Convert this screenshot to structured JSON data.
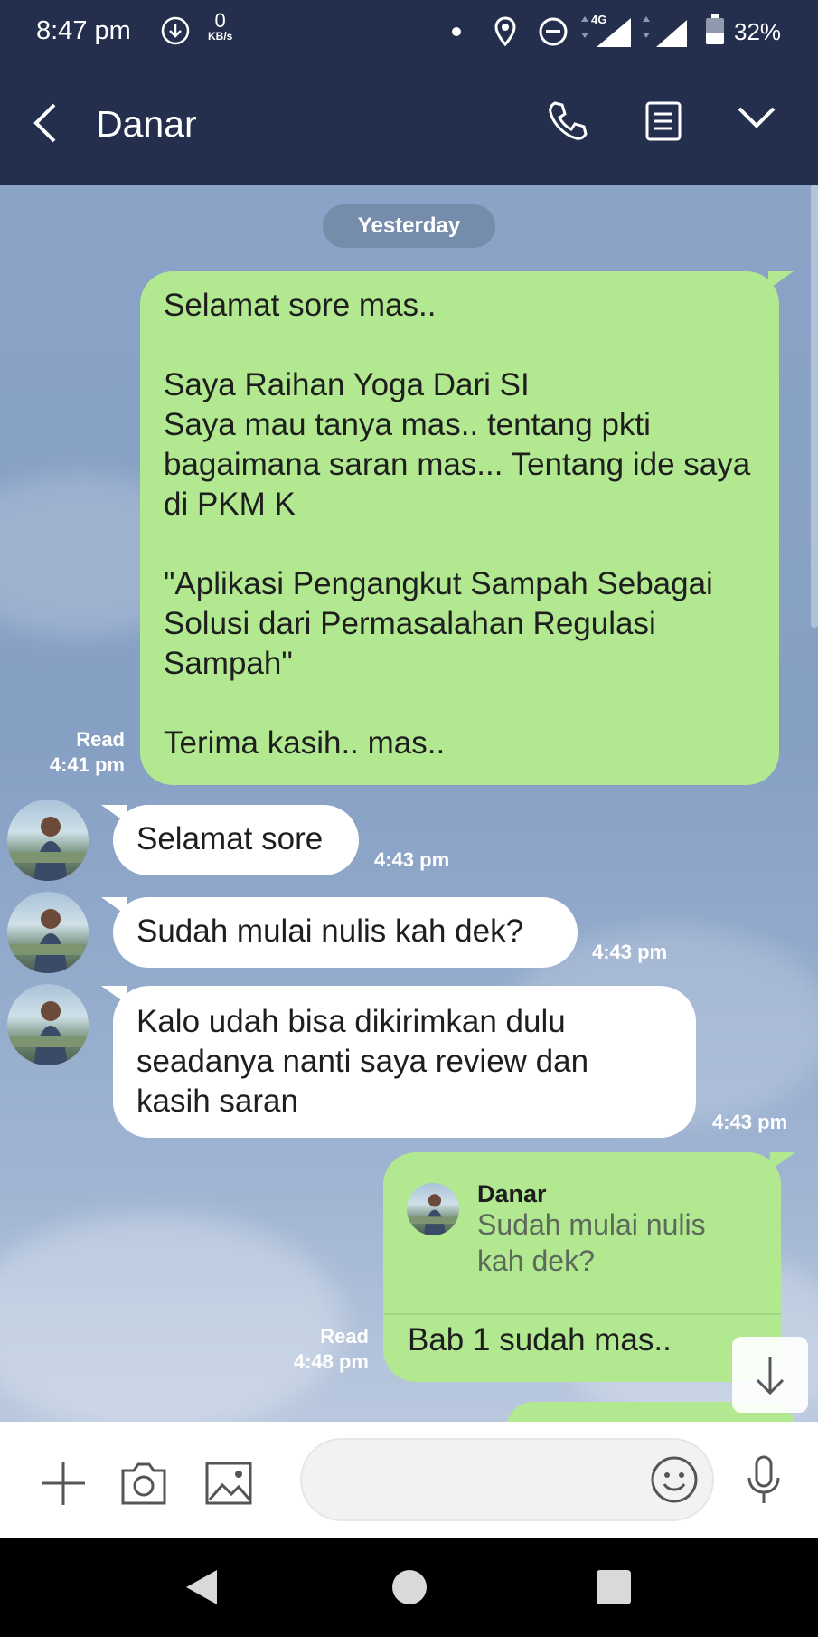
{
  "status_bar": {
    "time": "8:47 pm",
    "net_speed_value": "0",
    "net_speed_unit": "KB/s",
    "network_type": "4G",
    "battery": "32%"
  },
  "header": {
    "contact_name": "Danar",
    "icons": [
      "back-icon",
      "phone-icon",
      "notes-icon",
      "chevron-down-icon"
    ]
  },
  "chat": {
    "date_separator": "Yesterday",
    "messages": [
      {
        "direction": "outgoing",
        "text": "Selamat sore mas..\n\nSaya Raihan Yoga Dari SI\nSaya mau tanya mas.. tentang pkti bagaimana saran mas... Tentang ide saya di PKM K\n\n\"Aplikasi Pengangkut Sampah Sebagai Solusi dari Permasalahan Regulasi Sampah\"\n\nTerima kasih.. mas..",
        "status": "Read",
        "time": "4:41 pm"
      },
      {
        "direction": "incoming",
        "text": "Selamat sore",
        "time": "4:43 pm"
      },
      {
        "direction": "incoming",
        "text": "Sudah mulai nulis kah dek?",
        "time": "4:43 pm"
      },
      {
        "direction": "incoming",
        "text": "Kalo udah bisa dikirimkan dulu\nseadanya nanti saya review dan\nkasih saran",
        "time": "4:43 pm"
      },
      {
        "direction": "outgoing",
        "reply_to_name": "Danar",
        "reply_to_text": "Sudah mulai nulis\nkah dek?",
        "text": "Bab 1 sudah mas..",
        "status": "Read",
        "time": "4:48 pm"
      }
    ]
  },
  "input_bar": {
    "placeholder": "",
    "icons": [
      "plus-icon",
      "camera-icon",
      "image-icon",
      "emoji-icon",
      "microphone-icon"
    ]
  },
  "colors": {
    "header_bg": "#232f4d",
    "outgoing_bubble": "#b1e890",
    "incoming_bubble": "#ffffff",
    "chat_bg": "#8aa3c6"
  }
}
